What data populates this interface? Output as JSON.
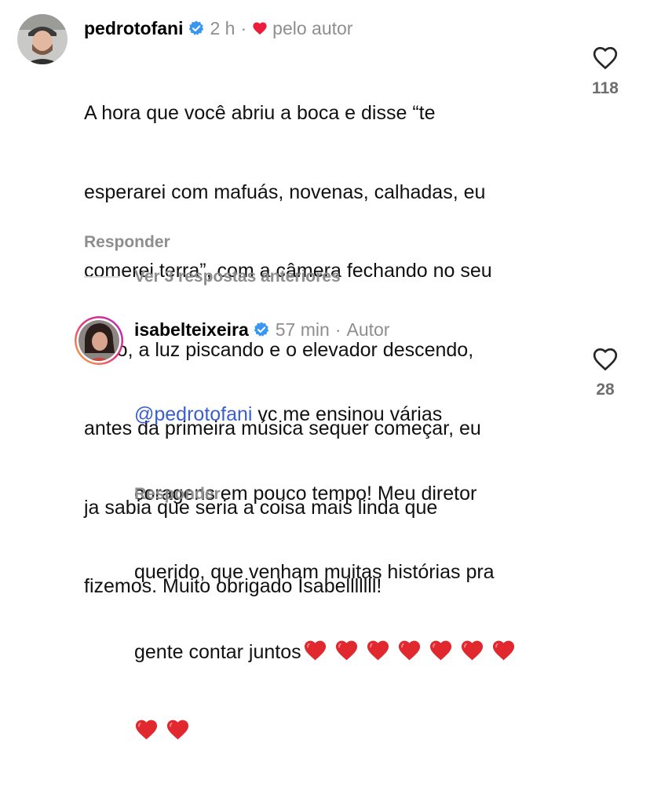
{
  "comment": {
    "username": "pedrotofani",
    "time": "2 h",
    "liked_by_author_label": "pelo autor",
    "text_lines": [
      "A hora que você abriu a boca e disse “te",
      "esperarei com mafuás, novenas, calhadas, eu",
      "comerei terra”, com a câmera fechando no seu",
      "rosto, a luz piscando e o elevador descendo,",
      "antes da primeira música sequer começar, eu",
      "ja sabia que seria a coisa mais linda que",
      "fizemos. Muito obrigado Isabelllllll!"
    ],
    "like_count": "118",
    "reply_label": "Responder",
    "avatar_icon": "avatar-man-cap",
    "verified_icon": "verified-badge-icon",
    "heart_color": "#ed1c3c"
  },
  "view_replies_label": "Ver 3 respostas anteriores",
  "reply": {
    "username": "isabelteixeira",
    "time": "57 min",
    "author_label": "Autor",
    "mention": "@pedrotofani",
    "text_first_rest": " vc me ensinou várias",
    "text_lines": [
      "coragens em pouco tempo! Meu diretor",
      "querido, que venham muitas histórias pra",
      "gente contar juntos"
    ],
    "hearts_emoji": "❤️❤️❤️❤️❤️❤️❤️❤️❤️",
    "like_count": "28",
    "reply_label": "Responder",
    "avatar_icon": "avatar-woman-story-ring",
    "mention_color": "#3a5fcd"
  }
}
